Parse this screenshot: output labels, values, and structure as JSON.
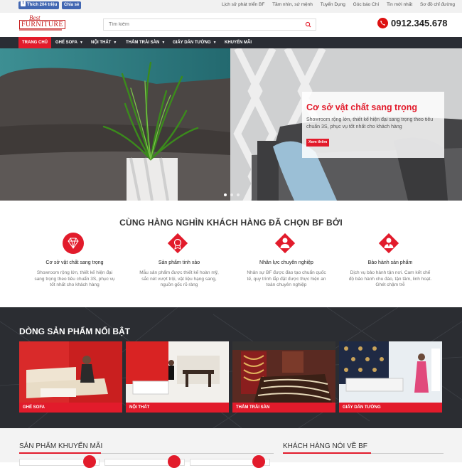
{
  "topbar": {
    "like_button": "Thích 204 triệu",
    "share_button": "Chia sẻ",
    "links": [
      "Lịch sử phát triển BF",
      "Tầm nhìn, sứ mệnh",
      "Tuyển Dụng",
      "Góc báo Chí",
      "Tin mới nhất",
      "Sơ đồ chỉ đường"
    ]
  },
  "header": {
    "logo_top": "Best",
    "logo_main": "FURNITURE",
    "search_placeholder": "Tìm kiếm",
    "hotline": "0912.345.678"
  },
  "nav": [
    {
      "label": "Trang chủ",
      "active": true,
      "dropdown": false
    },
    {
      "label": "Ghế Sofa",
      "dropdown": true
    },
    {
      "label": "Nội thất",
      "dropdown": true
    },
    {
      "label": "Thảm trải sàn",
      "dropdown": true
    },
    {
      "label": "Giấy dán tường",
      "dropdown": true
    },
    {
      "label": "Khuyến mãi",
      "dropdown": false
    }
  ],
  "hero": {
    "title": "Cơ sở vật chất sang trọng",
    "text": "Showroom rộng lớn, thiết kế hiện đại sang trọng theo tiêu chuẩn 3S, phục vụ tốt nhất cho khách hàng",
    "button": "Xem thêm",
    "slide_index": 1,
    "slide_count": 3
  },
  "why": {
    "title": "CÙNG HÀNG NGHÌN KHÁCH HÀNG ĐÃ CHỌN BF BỞI",
    "features": [
      {
        "icon": "diamond-icon",
        "title": "Cơ sở vật chất sang trọng",
        "text": "Showroom rộng lớn, thiết kế hiện đại sang trọng theo tiêu chuẩn 3S, phục vụ tốt nhất cho khách hàng"
      },
      {
        "icon": "quality-icon",
        "title": "Sản phẩm tinh xảo",
        "text": "Mẫu sản phẩm được thiết kế hoàn mỹ, sắc nét vượt trội, vật liệu hạng sang, nguồn gốc rõ ràng"
      },
      {
        "icon": "staff-icon",
        "title": "Nhân lực chuyên nghiệp",
        "text": "Nhân sự BF được đào tạo chuẩn quốc tế, quy trình lắp đặt được thực hiện an toàn chuyên nghiệp"
      },
      {
        "icon": "warranty-icon",
        "title": "Bảo hành sản phẩm",
        "text": "Dịch vụ bảo hành tận nơi. Cam kết chế độ bảo hành chu đáo, tận tâm, linh hoạt. Ghét chậm trễ"
      }
    ]
  },
  "featured": {
    "title": "DÒNG SẢN PHẨM NỔI BẬT",
    "categories": [
      "Ghế Sofa",
      "Nội thất",
      "Thảm trải sàn",
      "Giấy dán tường"
    ]
  },
  "bottom": {
    "promo_title": "SẢN PHẨM KHUYẾN MÃI",
    "testimonial_title": "KHÁCH HÀNG NÓI VỀ BF"
  },
  "colors": {
    "accent": "#e21b2b",
    "nav_bg": "#2a2d34",
    "dark_bg": "#2b2d32",
    "facebook": "#4267b2"
  }
}
